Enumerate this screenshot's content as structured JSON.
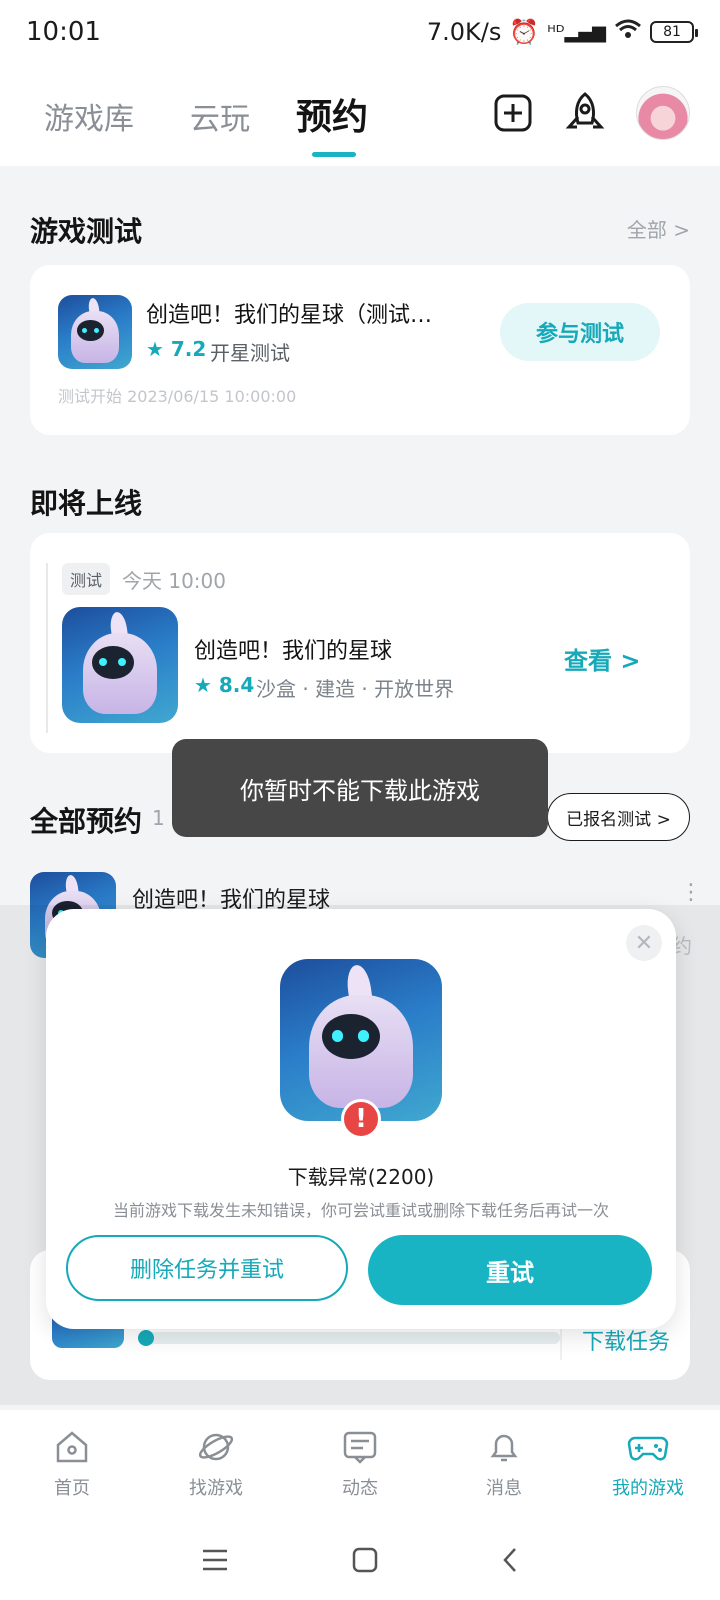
{
  "status_bar": {
    "time": "10:01",
    "network_speed": "7.0K/s",
    "battery": "81",
    "icons": [
      "alarm-icon",
      "hd-signal-icon",
      "wifi-icon",
      "battery-icon"
    ]
  },
  "top_nav": {
    "tabs": [
      {
        "label": "游戏库"
      },
      {
        "label": "云玩"
      },
      {
        "label": "预约",
        "active": true
      }
    ],
    "icons": [
      "add-square-icon",
      "rocket-icon",
      "avatar"
    ]
  },
  "game_test": {
    "title": "游戏测试",
    "more": "全部 >",
    "item": {
      "name": "创造吧！我们的星球（测试…",
      "rating": "★ 7.2",
      "status": "开星测试",
      "start_time": "测试开始 2023/06/15 10:00:00",
      "action": "参与测试"
    }
  },
  "upcoming": {
    "title": "即将上线",
    "badge": "测试",
    "time": "今天 10:00",
    "item": {
      "name": "创造吧！我们的星球",
      "rating": "★ 8.4",
      "tags": "沙盒 · 建造 · 开放世界",
      "action": "查看 >"
    }
  },
  "all_reservations": {
    "title": "全部预约",
    "count": "1",
    "filter": "已报名测试 >",
    "item_name": "创造吧！我们的星球",
    "item_status_partial": "约"
  },
  "toast": "你暂时不能下载此游戏",
  "modal": {
    "title": "下载异常(2200)",
    "description": "当前游戏下载发生未知错误，你可尝试重试或删除下载任务后再试一次",
    "buttons": {
      "secondary": "删除任务并重试",
      "primary": "重试"
    }
  },
  "download_card": {
    "link": "下载任务",
    "progress": 0.01
  },
  "bottom_nav": [
    {
      "label": "首页",
      "icon": "home-icon"
    },
    {
      "label": "找游戏",
      "icon": "planet-icon"
    },
    {
      "label": "动态",
      "icon": "message-card-icon"
    },
    {
      "label": "消息",
      "icon": "bell-icon"
    },
    {
      "label": "我的游戏",
      "icon": "gamepad-icon",
      "active": true
    }
  ],
  "colors": {
    "accent": "#19b4c4",
    "toast_bg": "#474747",
    "warning": "#e84545"
  }
}
